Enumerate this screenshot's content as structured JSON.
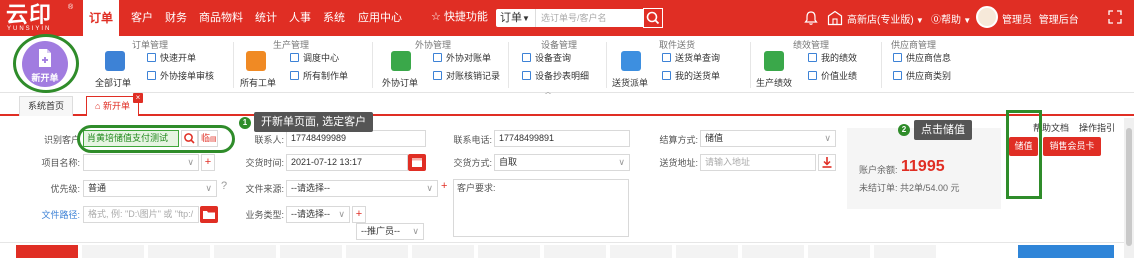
{
  "brand": {
    "logo_text": "云印",
    "logo_sub": "YUNSIYIN",
    "reg_mark": "®"
  },
  "topnav": {
    "items": [
      "订单",
      "客户",
      "财务",
      "商品物料",
      "统计",
      "人事",
      "系统",
      "应用中心"
    ],
    "quick_label": "快捷功能",
    "search_type": "订单",
    "search_placeholder": "选订单号/客户名",
    "store": "高新店(专业版)",
    "help": "帮助",
    "user": "管理员",
    "admin": "管理后台"
  },
  "ribbon": {
    "new_order": "新开单",
    "groups": {
      "order": "订单管理",
      "production": "生产管理",
      "outsource": "外协管理",
      "device": "设备管理",
      "pickup": "取件送货",
      "perf": "绩效管理",
      "supplier": "供应商管理"
    },
    "all_orders": "全部订单",
    "quick_order": "快速开单",
    "outsource_review": "外协接单审核",
    "all_work": "所有工单",
    "dispatch_center": "调度中心",
    "all_production": "所有制作单",
    "outsource_order": "外协订单",
    "outsource_reconcile": "外协对账单",
    "reconcile_record": "对账核销记录",
    "device_query": "设备查询",
    "device_meter": "设备抄表明细",
    "delivery_dispatch": "送货派单",
    "delivery_query": "送货单查询",
    "my_delivery": "我的送货单",
    "prod_perf": "生产绩效",
    "my_perf": "我的绩效",
    "value_perf": "价值业绩",
    "supplier_info": "供应商信息",
    "supplier_type": "供应商类别"
  },
  "tabs": {
    "home": "系统首页",
    "new_order": "新开单"
  },
  "form": {
    "identify_customer_label": "识别客户",
    "customer_value": "肖黄培储值支付测试",
    "temp_label": "临",
    "project_label": "项目名称:",
    "priority_label": "优先级:",
    "priority_value": "普通",
    "file_path_label": "文件路径:",
    "file_path_placeholder": "格式, 例: \"D:\\图片\" 或 \"ftp:/",
    "contact_label": "联系人:",
    "contact_value": "17748499989",
    "time_label": "交货时间:",
    "time_value": "2021-07-12 13:17",
    "source_label": "文件来源:",
    "source_value": "--请选择--",
    "biz_type_label": "业务类型:",
    "biz_type_value": "--请选择--",
    "promoter_value": "--推广员--",
    "phone_label": "联系电话:",
    "phone_value": "17748499891",
    "delivery_label": "交货方式:",
    "delivery_value": "自取",
    "requirements_label": "客户要求:",
    "settle_label": "结算方式:",
    "settle_value": "储值",
    "address_label": "送货地址:",
    "address_placeholder": "请输入地址"
  },
  "tips": {
    "tip1_num": "1",
    "tip1": "开新单页面, 选定客户",
    "tip2_num": "2",
    "tip2": "点击储值"
  },
  "account": {
    "balance_label": "账户余额:",
    "balance": "11995",
    "unsettled": "未结订单: 共2单/54.00 元",
    "help_doc": "帮助文档",
    "op_guide": "操作指引",
    "charge_btn": "储值",
    "member_card_btn": "销售会员卡"
  },
  "colors": {
    "brand_red": "#e02e24",
    "highlight_green": "#2f8c2a",
    "new_btn_purple": "#a17ce0"
  }
}
